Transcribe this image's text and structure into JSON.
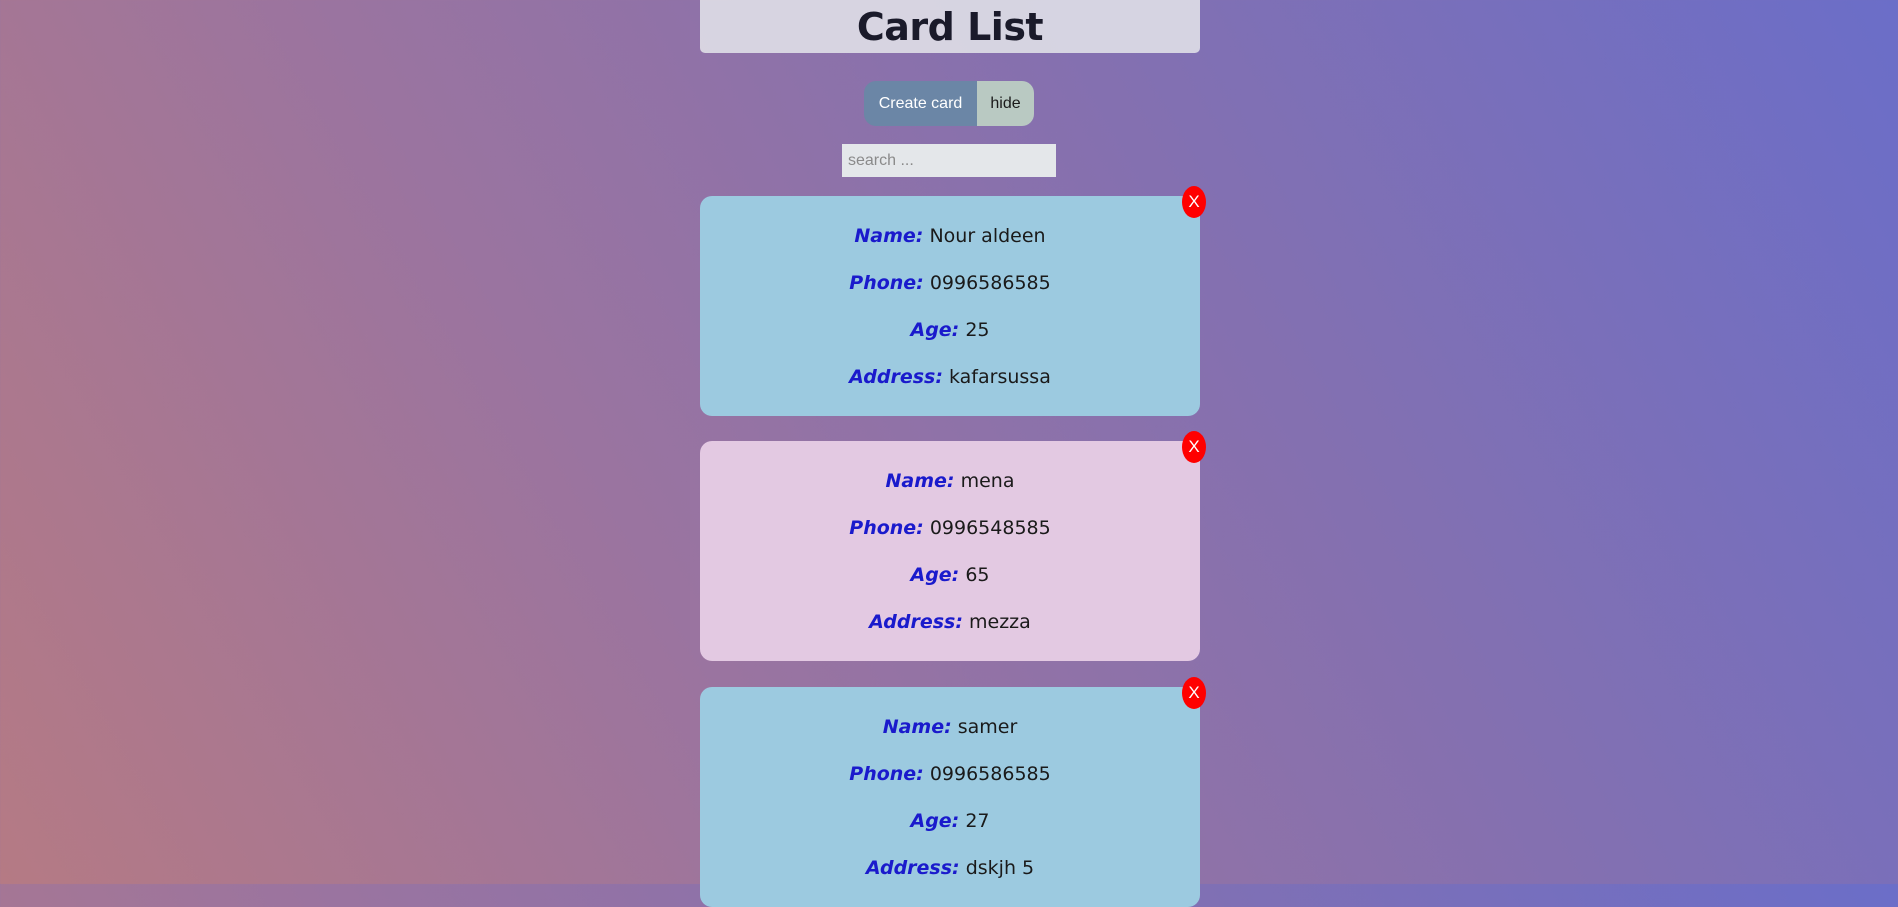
{
  "page": {
    "title": "Card List"
  },
  "toolbar": {
    "create_label": "Create card",
    "hide_label": "hide"
  },
  "search": {
    "placeholder": "search ...",
    "value": ""
  },
  "labels": {
    "name": "Name:",
    "phone": "Phone:",
    "age": "Age:",
    "address": "Address:",
    "close": "X"
  },
  "cards": [
    {
      "name": "Nour aldeen",
      "phone": "0996586585",
      "age": "25",
      "address": "kafarsussa",
      "color": "#9ccae0"
    },
    {
      "name": "mena",
      "phone": "0996548585",
      "age": "65",
      "address": "mezza",
      "color": "#e3c9e2"
    },
    {
      "name": "samer",
      "phone": "0996586585",
      "age": "27",
      "address": "dskjh 5",
      "color": "#9ccae0"
    }
  ],
  "colors": {
    "label": "#1a1acc",
    "close_button": "#ff0000",
    "create_button": "#6b86a6",
    "hide_button": "#b9c9c2"
  }
}
